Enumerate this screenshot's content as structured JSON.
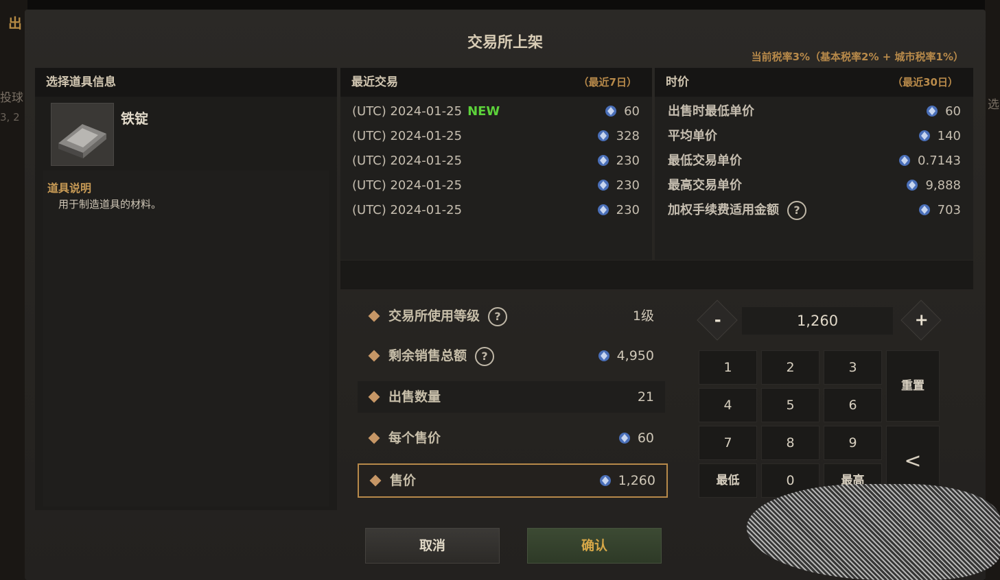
{
  "background": {
    "left_title": "出",
    "left_text_1": "投球",
    "left_text_2": "3, 2",
    "right_text": "选"
  },
  "dialog": {
    "title": "交易所上架",
    "tax_note": "当前税率3%（基本税率2% + 城市税率1%）"
  },
  "item_panel": {
    "header": "选择道具信息",
    "item_name": "铁锭",
    "desc_title": "道具说明",
    "desc_text": "用于制造道具的材料。"
  },
  "recent": {
    "header": "最近交易",
    "range": "（最近7日）",
    "new_badge": "NEW",
    "rows": [
      {
        "date": "(UTC) 2024-01-25",
        "price": "60"
      },
      {
        "date": "(UTC) 2024-01-25",
        "price": "328"
      },
      {
        "date": "(UTC) 2024-01-25",
        "price": "230"
      },
      {
        "date": "(UTC) 2024-01-25",
        "price": "230"
      },
      {
        "date": "(UTC) 2024-01-25",
        "price": "230"
      }
    ]
  },
  "market_price": {
    "header": "时价",
    "range": "（最近30日）",
    "rows": [
      {
        "label": "出售时最低单价",
        "value": "60"
      },
      {
        "label": "平均单价",
        "value": "140"
      },
      {
        "label": "最低交易单价",
        "value": "0.7143"
      },
      {
        "label": "最高交易单价",
        "value": "9,888"
      },
      {
        "label": "加权手续费适用金额",
        "value": "703"
      }
    ]
  },
  "form": {
    "level_label": "交易所使用等级",
    "level_value": "1级",
    "remaining_label": "剩余销售总额",
    "remaining_value": "4,950",
    "qty_label": "出售数量",
    "qty_value": "21",
    "unit_label": "每个售价",
    "unit_value": "60",
    "total_label": "售价",
    "total_value": "1,260"
  },
  "stepper": {
    "minus": "-",
    "plus": "+",
    "value": "1,260"
  },
  "keypad": {
    "k1": "1",
    "k2": "2",
    "k3": "3",
    "k4": "4",
    "k5": "5",
    "k6": "6",
    "k7": "7",
    "k8": "8",
    "k9": "9",
    "k0": "0",
    "min": "最低",
    "max": "最高",
    "reset": "重置",
    "back": "<"
  },
  "buttons": {
    "cancel": "取消",
    "confirm": "确认"
  },
  "icons": {
    "currency": "silver-gem-icon",
    "help": "question-circle-icon"
  },
  "colors": {
    "accent": "#b88a4a",
    "new": "#5cd23a",
    "confirm_text": "#d7a848"
  }
}
